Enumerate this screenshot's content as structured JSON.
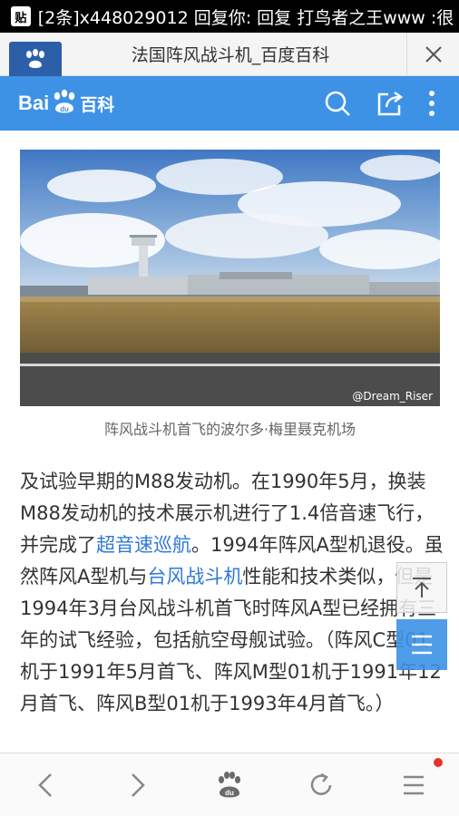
{
  "status_bar": {
    "icon_label": "贴",
    "notification": "[2条]x448029012 回复你: 回复 打鸟者之王www :很"
  },
  "title_bar": {
    "title": "法国阵风战斗机_百度百科"
  },
  "header": {
    "logo_bai": "Bai",
    "logo_ke": "百科",
    "brand_color": "#3d92e6"
  },
  "content": {
    "image_watermark": "@Dream_Riser",
    "caption": "阵风战斗机首飞的波尔多·梅里聂克机场",
    "paragraph": {
      "p1": "及试验早期的M88发动机。在1990年5月，换装M88发动机的技术展示机进行了1.4倍音速飞行，并完成了",
      "link1": "超音速巡航",
      "p2": "。1994年阵风A型机退役。虽然阵风A型机与",
      "link2": "台风战斗机",
      "p3": "性能和技术类似，但是1994年3月台风战斗机首飞时阵风A型已经拥有三年的试飞经验，包括航空母舰试验。（阵风C型01机于1991年5月首飞、阵风M型01机于1991年12月首飞、阵风B型01机于1993年4月首飞。）"
    },
    "link_color": "#2f79d8"
  },
  "icons": [
    "close-icon",
    "search-icon",
    "share-icon",
    "more-vertical-icon",
    "back-to-top-icon",
    "list-icon",
    "back-arrow-icon",
    "forward-arrow-icon",
    "baidu-paw-icon",
    "refresh-icon",
    "menu-icon"
  ]
}
